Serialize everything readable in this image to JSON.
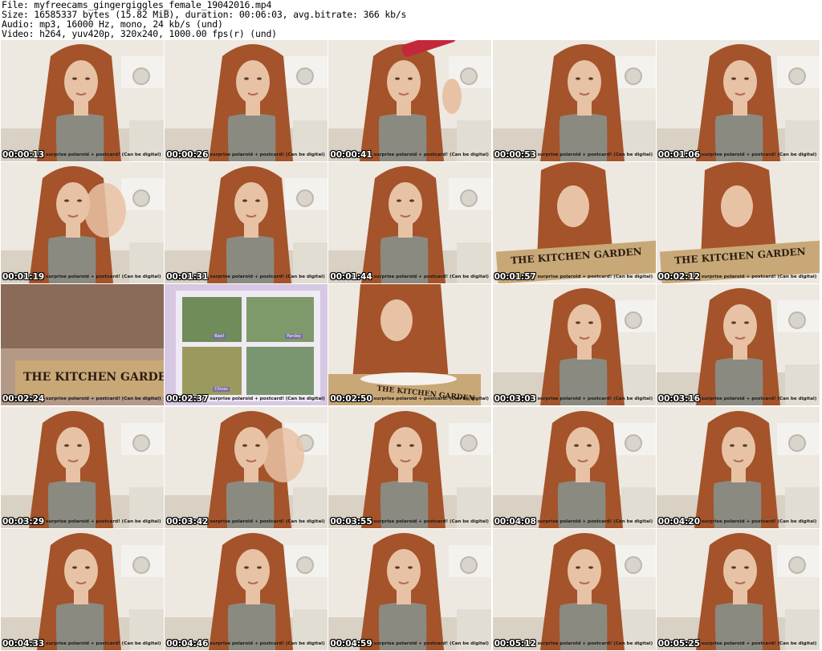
{
  "header": {
    "file_line": "File: myfreecams_gingergiggles_female_19042016.mp4",
    "size_line": "Size: 16585337 bytes (15.82 MiB), duration: 00:06:03, avg.bitrate: 366 kb/s",
    "audio_line": "Audio: mp3, 16000 Hz, mono, 24 kb/s (und)",
    "video_line": "Video: h264, yuv420p, 320x240, 1000.00 fps(r) (und)"
  },
  "caption": "surprise polaroid + postcard! (Can be digital)",
  "sign_text": "THE KITCHEN GARDEN",
  "plant_labels": [
    "Basil",
    "Parsley",
    "Chives"
  ],
  "thumbnails": [
    {
      "time": "00:00:13",
      "scene": "face"
    },
    {
      "time": "00:00:26",
      "scene": "face"
    },
    {
      "time": "00:00:41",
      "scene": "drink"
    },
    {
      "time": "00:00:53",
      "scene": "face"
    },
    {
      "time": "00:01:06",
      "scene": "face"
    },
    {
      "time": "00:01:19",
      "scene": "blur"
    },
    {
      "time": "00:01:31",
      "scene": "face"
    },
    {
      "time": "00:01:44",
      "scene": "face"
    },
    {
      "time": "00:01:57",
      "scene": "sign"
    },
    {
      "time": "00:02:12",
      "scene": "sign"
    },
    {
      "time": "00:02:24",
      "scene": "box"
    },
    {
      "time": "00:02:37",
      "scene": "seeds"
    },
    {
      "time": "00:02:50",
      "scene": "box2"
    },
    {
      "time": "00:03:03",
      "scene": "face"
    },
    {
      "time": "00:03:16",
      "scene": "face"
    },
    {
      "time": "00:03:29",
      "scene": "face"
    },
    {
      "time": "00:03:42",
      "scene": "blur"
    },
    {
      "time": "00:03:55",
      "scene": "face"
    },
    {
      "time": "00:04:08",
      "scene": "face"
    },
    {
      "time": "00:04:20",
      "scene": "face"
    },
    {
      "time": "00:04:33",
      "scene": "face"
    },
    {
      "time": "00:04:46",
      "scene": "face"
    },
    {
      "time": "00:04:59",
      "scene": "face"
    },
    {
      "time": "00:05:12",
      "scene": "face"
    },
    {
      "time": "00:05:25",
      "scene": "face"
    }
  ],
  "colors": {
    "wall": "#ede8e0",
    "hair": "#a4532a",
    "skin": "#e8c2a5",
    "top": "#8a8a80",
    "wood": "#c9a878"
  }
}
